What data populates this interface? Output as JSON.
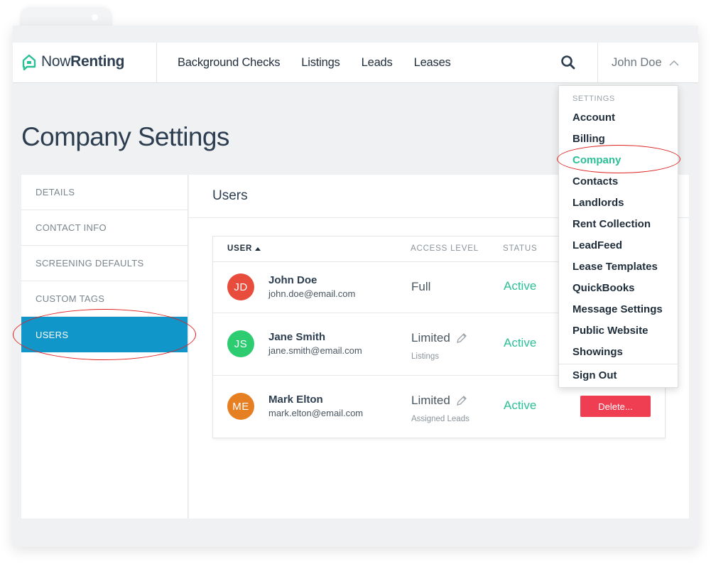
{
  "app": {
    "logo_light": "Now",
    "logo_bold": "Renting",
    "brand_color": "#2bbf95"
  },
  "nav": [
    "Background Checks",
    "Listings",
    "Leads",
    "Leases"
  ],
  "user_menu": {
    "name": "John Doe",
    "icon": "chevron-up-icon"
  },
  "page": {
    "title": "Company Settings"
  },
  "sidebar": {
    "items": [
      {
        "label": "DETAILS"
      },
      {
        "label": "CONTACT INFO"
      },
      {
        "label": "SCREENING DEFAULTS"
      },
      {
        "label": "CUSTOM TAGS"
      },
      {
        "label": "USERS",
        "active": true
      }
    ],
    "active_color": "#1196c9"
  },
  "users_panel": {
    "title": "Users",
    "columns": {
      "user": "USER",
      "access": "ACCESS LEVEL",
      "status": "STATUS"
    },
    "rows": [
      {
        "initials": "JD",
        "avatar_color": "#e74c3c",
        "name": "John Doe",
        "email": "john.doe@email.com",
        "access": "Full",
        "access_sub": "",
        "status": "Active",
        "action": ""
      },
      {
        "initials": "JS",
        "avatar_color": "#2ecc71",
        "name": "Jane Smith",
        "email": "jane.smith@email.com",
        "access": "Limited",
        "access_sub": "Listings",
        "status": "Active",
        "action": ""
      },
      {
        "initials": "ME",
        "avatar_color": "#e67e22",
        "name": "Mark Elton",
        "email": "mark.elton@email.com",
        "access": "Limited",
        "access_sub": "Assigned Leads",
        "status": "Active",
        "action": "Delete..."
      }
    ]
  },
  "dropdown": {
    "heading": "SETTINGS",
    "items": [
      "Account",
      "Billing",
      "Company",
      "Contacts",
      "Landlords",
      "Rent Collection",
      "LeadFeed",
      "Lease Templates",
      "QuickBooks",
      "Message Settings",
      "Public Website",
      "Showings"
    ],
    "active": "Company",
    "sign_out": "Sign Out"
  }
}
